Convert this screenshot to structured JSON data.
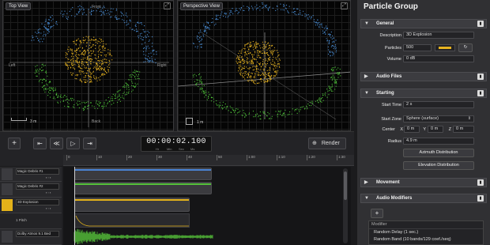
{
  "viewports": {
    "top": {
      "title": "Top View",
      "front": "Front",
      "back": "Back",
      "left": "Left",
      "right": "Right",
      "scale": "3 m",
      "expand_icon": "expand-icon"
    },
    "perspective": {
      "title": "Perspective View",
      "scale": "1 m",
      "expand_icon": "expand-icon"
    }
  },
  "transport": {
    "add_label": "+",
    "timecode": "00:00:02.100",
    "time_units": [
      "Hr",
      "Min",
      "Sec",
      "Ms"
    ],
    "render_label": "Render"
  },
  "timeline": {
    "ruler_ticks": [
      "0",
      "10",
      "20",
      "30",
      "40",
      "50",
      "1:00",
      "1:10",
      "1:20",
      "1:30"
    ],
    "tracks": [
      {
        "name": "Magic Debris #1"
      },
      {
        "name": "Magic Debris #2"
      },
      {
        "name": "3D Explosion"
      },
      {
        "name": "1 Pitch"
      },
      {
        "name": "Dolby Atmos 9.1 Bed"
      }
    ]
  },
  "inspector": {
    "title": "Particle Group",
    "sections": {
      "general": "General",
      "audio_files": "Audio Files",
      "starting": "Starting",
      "movement": "Movement",
      "audio_modifiers": "Audio Modifiers"
    },
    "general": {
      "description_label": "Description",
      "description_value": "3D Explosion",
      "particles_label": "Particles",
      "particles_value": "500",
      "volume_label": "Volume",
      "volume_value": "0 dB"
    },
    "starting": {
      "start_time_label": "Start Time",
      "start_time_value": "2 s",
      "start_zone_label": "Start Zone",
      "start_zone_value": "Sphere (surface)",
      "center_label": "Center",
      "x_label": "X",
      "x_value": "0 m",
      "y_label": "Y",
      "y_value": "0 m",
      "z_label": "Z",
      "z_value": "0 m",
      "radius_label": "Radius",
      "radius_value": "4.9 m",
      "azimuth_button": "Azimuth Distribution",
      "elevation_button": "Elevation Distribution"
    },
    "modifiers": {
      "add_label": "+",
      "header": "Modifier",
      "items": [
        "Random Delay (1 sec.)",
        "Random Band (10 bands/129 coef./seq)"
      ]
    }
  },
  "colors": {
    "accent_yellow": "#e7b320",
    "particle_blue": "#4a8fd8",
    "particle_green": "#4fc53a",
    "track_blue": "#4a84d4",
    "track_green": "#55c23a",
    "track_yellow": "#e3b21a"
  }
}
